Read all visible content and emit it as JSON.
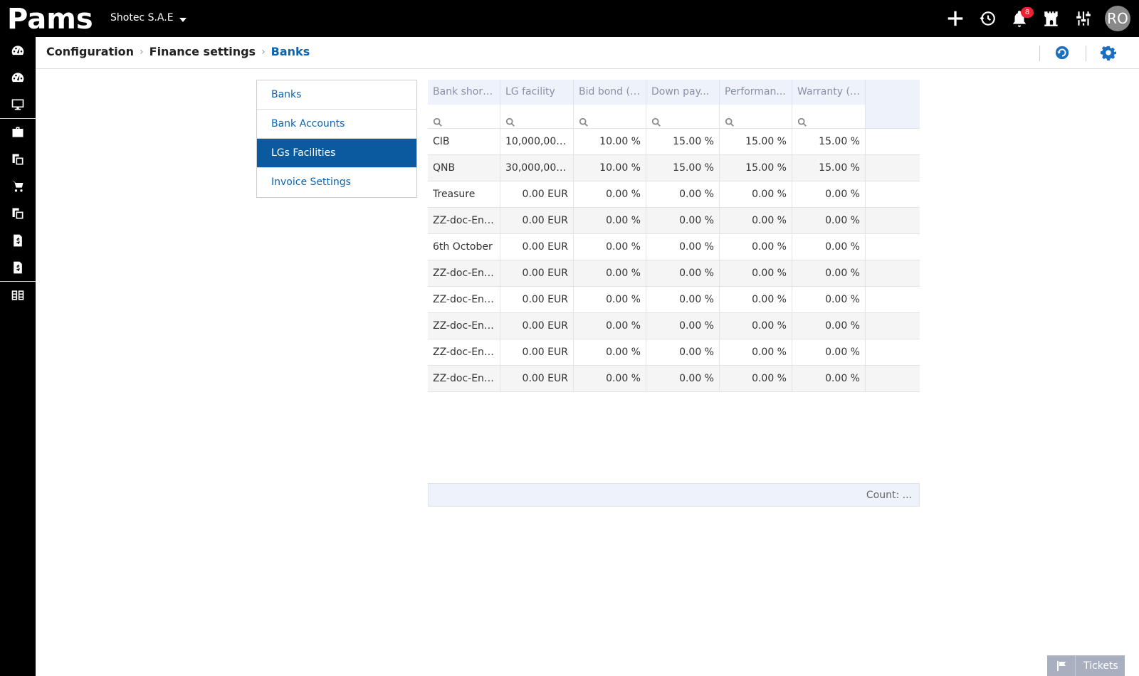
{
  "app": {
    "logo_text": "Pams",
    "company": "Shotec S.A.E",
    "notifications_count": "8",
    "user_initials": "RO"
  },
  "breadcrumb": [
    "Configuration",
    "Finance settings",
    "Banks"
  ],
  "side_menu": [
    {
      "label": "Banks",
      "active": false
    },
    {
      "label": "Bank Accounts",
      "active": false
    },
    {
      "label": "LGs Facilities",
      "active": true
    },
    {
      "label": "Invoice Settings",
      "active": false
    }
  ],
  "grid": {
    "columns": [
      "Bank short ...",
      "LG facility",
      "Bid bond (%)",
      "Down pay...",
      "Performan...",
      "Warranty (%)"
    ],
    "rows": [
      [
        "CIB",
        "10,000,000....",
        "10.00 %",
        "15.00 %",
        "15.00 %",
        "15.00 %"
      ],
      [
        "QNB",
        "30,000,000....",
        "10.00 %",
        "15.00 %",
        "15.00 %",
        "15.00 %"
      ],
      [
        "Treasure",
        "0.00 EUR",
        "0.00 %",
        "0.00 %",
        "0.00 %",
        "0.00 %"
      ],
      [
        "ZZ-doc-Ent...",
        "0.00 EUR",
        "0.00 %",
        "0.00 %",
        "0.00 %",
        "0.00 %"
      ],
      [
        "6th October",
        "0.00 EUR",
        "0.00 %",
        "0.00 %",
        "0.00 %",
        "0.00 %"
      ],
      [
        "ZZ-doc-Ent...",
        "0.00 EUR",
        "0.00 %",
        "0.00 %",
        "0.00 %",
        "0.00 %"
      ],
      [
        "ZZ-doc-Ent...",
        "0.00 EUR",
        "0.00 %",
        "0.00 %",
        "0.00 %",
        "0.00 %"
      ],
      [
        "ZZ-doc-Ent...",
        "0.00 EUR",
        "0.00 %",
        "0.00 %",
        "0.00 %",
        "0.00 %"
      ],
      [
        "ZZ-doc-Ent...",
        "0.00 EUR",
        "0.00 %",
        "0.00 %",
        "0.00 %",
        "0.00 %"
      ],
      [
        "ZZ-doc-Ent...",
        "0.00 EUR",
        "0.00 %",
        "0.00 %",
        "0.00 %",
        "0.00 %"
      ]
    ],
    "footer": "Count: ..."
  },
  "tickets_label": "Tickets",
  "colors": {
    "accent": "#0b64b0",
    "active_menu": "#0b5aa0",
    "topbar": "#000000",
    "grid_header": "#eef2fa",
    "badge": "#ee2233"
  }
}
